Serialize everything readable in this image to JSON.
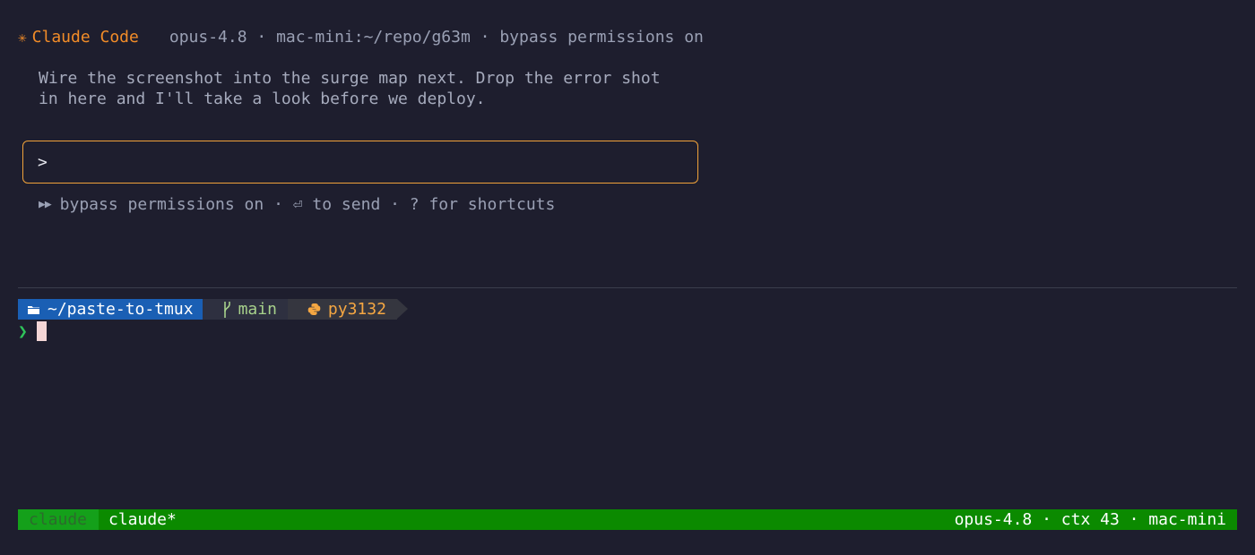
{
  "header": {
    "app_name": "Claude Code",
    "meta": "opus-4.8 · mac-mini:~/repo/g63m · bypass permissions on"
  },
  "message": {
    "line1": "Wire the screenshot into the surge map next. Drop the error shot",
    "line2": "in here and I'll take a look before we deploy."
  },
  "input": {
    "prompt": ">",
    "value": ""
  },
  "hint": {
    "text": "bypass permissions on · ⏎ to send · ? for shortcuts"
  },
  "shell": {
    "directory": "~/paste-to-tmux",
    "git_branch": "main",
    "python_env": "py3132",
    "prompt_symbol": "❯"
  },
  "status_bar": {
    "session": "claude",
    "window": "claude*",
    "right": "opus-4.8 · ctx 43 · mac-mini"
  },
  "colors": {
    "background": "#1e1e2e",
    "accent": "#f28c28",
    "input_border": "#f0a23a",
    "dir_segment": "#1a5fb4",
    "git_text": "#a7d18b",
    "python_text": "#f5a742",
    "status_bar": "#0b8a00",
    "prompt_chevron": "#2fc45a"
  },
  "icons": {
    "header": "asterisk-icon",
    "hint": "double-arrow-icon",
    "dir": "folder-icon",
    "git": "git-branch-icon",
    "python": "python-icon"
  }
}
